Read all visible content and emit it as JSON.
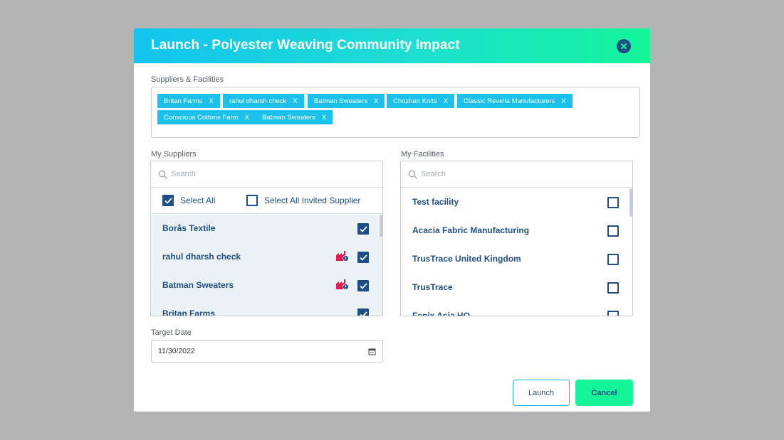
{
  "modal": {
    "title": "Launch - Polyester Weaving Community Impact",
    "colors": {
      "header_start": "#14c3ef",
      "header_end": "#14f59a",
      "primary": "#1f4e84",
      "tag": "#1bc1ea",
      "alert": "#e8194f"
    }
  },
  "selected": {
    "label": "Suppliers & Facilities",
    "tags": [
      {
        "label": "Britan Farms",
        "x": "X"
      },
      {
        "label": "rahul dharsh check",
        "x": "X"
      },
      {
        "label": "Batman Sweaters",
        "x": "X"
      },
      {
        "label": "Chozhan Knits",
        "x": "X"
      },
      {
        "label": "Classic Revella Manufacturers",
        "x": "X"
      },
      {
        "label": "Conscious Cottons Farm",
        "x": "X"
      },
      {
        "label": "Batman Sweaters",
        "x": "X"
      }
    ]
  },
  "suppliers": {
    "label": "My Suppliers",
    "search_placeholder": "Search",
    "select_all": {
      "label": "Select All",
      "checked": true
    },
    "select_all_invited": {
      "label": "Select All Invited Supplier",
      "checked": false
    },
    "items": [
      {
        "label": "Borås Textile",
        "checked": true,
        "alert_icon": false
      },
      {
        "label": "rahul dharsh check",
        "checked": true,
        "alert_icon": true
      },
      {
        "label": "Batman Sweaters",
        "checked": true,
        "alert_icon": true
      },
      {
        "label": "Britan Farms",
        "checked": true,
        "alert_icon": false
      }
    ]
  },
  "facilities": {
    "label": "My Facilities",
    "search_placeholder": "Search",
    "items": [
      {
        "label": "Test facility",
        "checked": false
      },
      {
        "label": "Acacia Fabric Manufacturing",
        "checked": false
      },
      {
        "label": "TrusTrace United Kingdom",
        "checked": false
      },
      {
        "label": "TrusTrace",
        "checked": false
      },
      {
        "label": "Fenix Asia HQ",
        "checked": false
      }
    ]
  },
  "target_date": {
    "label": "Target Date",
    "value": "11/30/2022",
    "icon": "calendar-icon"
  },
  "actions": {
    "launch": "Launch",
    "cancel": "Cancel"
  }
}
